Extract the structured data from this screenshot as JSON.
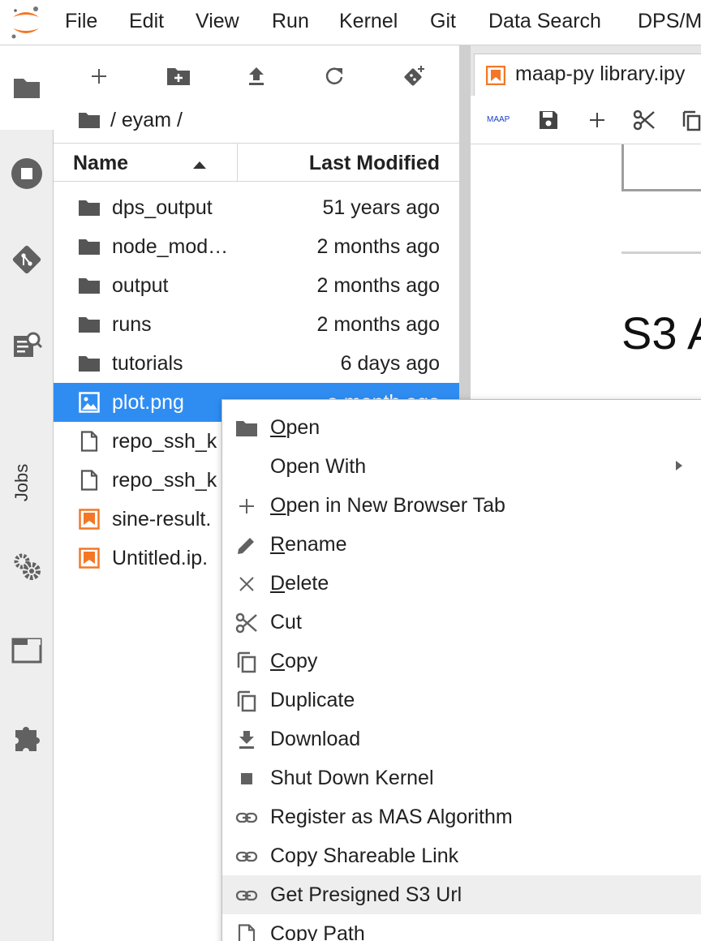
{
  "menubar": {
    "items": [
      "File",
      "Edit",
      "View",
      "Run",
      "Kernel",
      "Git",
      "Data Search",
      "DPS/M"
    ]
  },
  "activity": {
    "jobs_label": "Jobs"
  },
  "filebrowser": {
    "breadcrumb": "/ eyam /",
    "header_name": "Name",
    "header_modified": "Last Modified",
    "rows": [
      {
        "name": "dps_output",
        "modified": "51 years ago",
        "icon": "folder-icon"
      },
      {
        "name": "node_mod…",
        "modified": "2 months ago",
        "icon": "folder-icon"
      },
      {
        "name": "output",
        "modified": "2 months ago",
        "icon": "folder-icon"
      },
      {
        "name": "runs",
        "modified": "2 months ago",
        "icon": "folder-icon"
      },
      {
        "name": "tutorials",
        "modified": "6 days ago",
        "icon": "folder-icon"
      },
      {
        "name": "plot.png",
        "modified": "a month ago",
        "icon": "image-icon",
        "selected": true
      },
      {
        "name": "repo_ssh_k",
        "modified": "",
        "icon": "file-icon"
      },
      {
        "name": "repo_ssh_k",
        "modified": "",
        "icon": "file-icon"
      },
      {
        "name": "sine-result.",
        "modified": "",
        "icon": "notebook-icon"
      },
      {
        "name": "Untitled.ip.",
        "modified": "",
        "icon": "notebook-icon"
      }
    ]
  },
  "notebook": {
    "tab_label": "maap-py library.ipy",
    "maap_button": "MAAP",
    "heading": "S3 A"
  },
  "context_menu": {
    "items": [
      {
        "pre": "",
        "u": "O",
        "post": "pen",
        "icon": "folder-icon"
      },
      {
        "pre": "Open With",
        "u": "",
        "post": "",
        "icon": ""
      },
      {
        "pre": "",
        "u": "O",
        "post": "pen in New Browser Tab",
        "icon": "plus-icon"
      },
      {
        "pre": "",
        "u": "R",
        "post": "ename",
        "icon": "pencil-icon"
      },
      {
        "pre": "",
        "u": "D",
        "post": "elete",
        "icon": "close-icon"
      },
      {
        "pre": "Cut",
        "u": "",
        "post": "",
        "icon": "scissors-icon"
      },
      {
        "pre": "",
        "u": "C",
        "post": "opy",
        "icon": "copy-icon"
      },
      {
        "pre": "Duplicate",
        "u": "",
        "post": "",
        "icon": "copy-icon"
      },
      {
        "pre": "Download",
        "u": "",
        "post": "",
        "icon": "download-icon"
      },
      {
        "pre": "Shut Down Kernel",
        "u": "",
        "post": "",
        "icon": "stop-icon"
      },
      {
        "pre": "Register as MAS Algorithm",
        "u": "",
        "post": "",
        "icon": "link-icon"
      },
      {
        "pre": "Copy Shareable Link",
        "u": "",
        "post": "",
        "icon": "link-icon"
      },
      {
        "pre": "Get Presigned S3 Url",
        "u": "",
        "post": "",
        "icon": "link-icon",
        "hover": true
      },
      {
        "pre": "Copy Path",
        "u": "",
        "post": "",
        "icon": "file-icon"
      }
    ]
  },
  "colors": {
    "selection": "#2f8df2",
    "jupyter_orange": "#f37726",
    "icon_gray": "#616161"
  }
}
